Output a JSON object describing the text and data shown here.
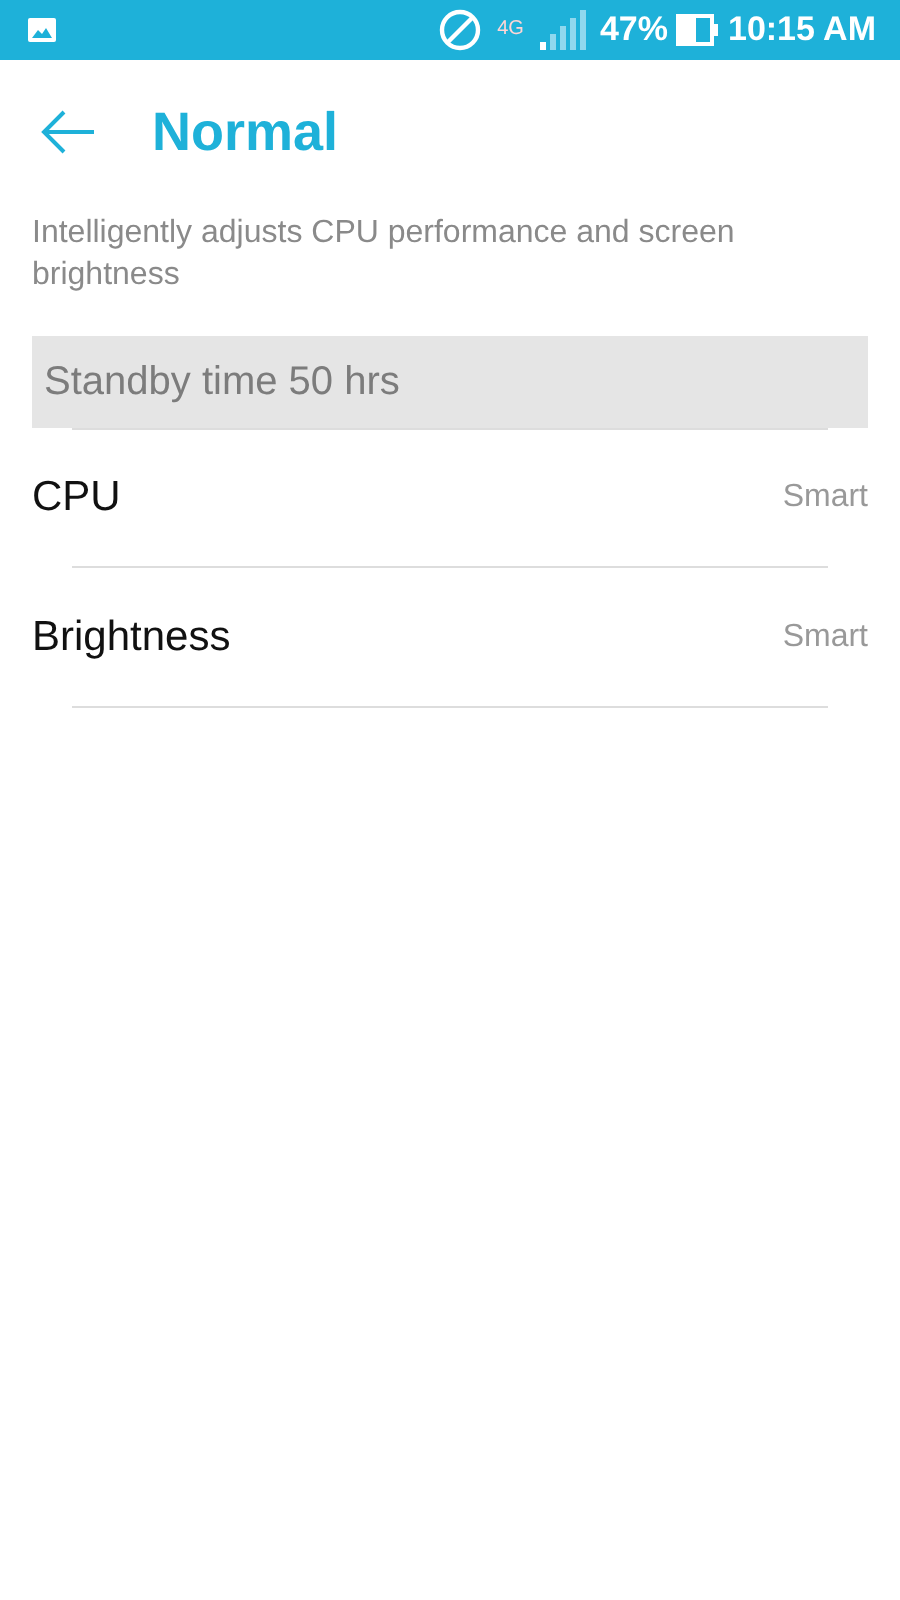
{
  "status_bar": {
    "network": "4G",
    "battery": "47%",
    "time": "10:15 AM"
  },
  "header": {
    "title": "Normal"
  },
  "description": "Intelligently adjusts CPU performance and screen brightness",
  "standby": "Standby time 50 hrs",
  "settings": [
    {
      "label": "CPU",
      "value": "Smart"
    },
    {
      "label": "Brightness",
      "value": "Smart"
    }
  ]
}
